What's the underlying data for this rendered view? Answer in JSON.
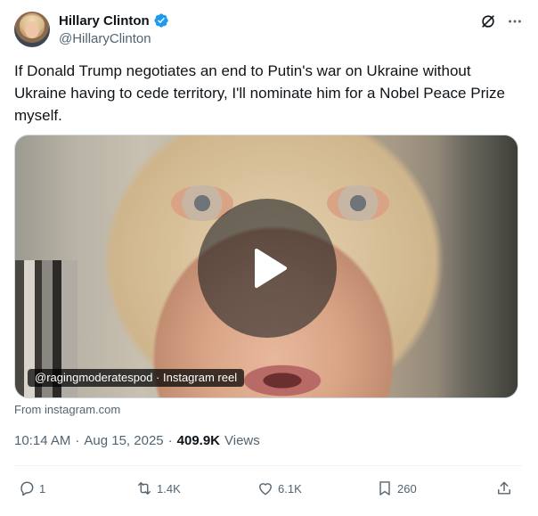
{
  "author": {
    "name": "Hillary Clinton",
    "handle": "@HillaryClinton",
    "verified": true
  },
  "tweet": {
    "text": "If Donald Trump negotiates an end to Putin's war on Ukraine without Ukraine having to cede territory, I'll nominate him for a Nobel Peace Prize myself."
  },
  "media": {
    "tag": "@ragingmoderatespod · Instagram reel",
    "source": "From instagram.com"
  },
  "meta": {
    "time": "10:14 AM",
    "separator": "·",
    "date": "Aug 15, 2025",
    "separator2": "·",
    "views_count": "409.9K",
    "views_label": "Views"
  },
  "actions": {
    "replies": "1",
    "reposts": "1.4K",
    "likes": "6.1K",
    "bookmarks": "260"
  },
  "colors": {
    "verified": "#1d9bf0",
    "text": "#0f1419",
    "secondary": "#536471"
  }
}
